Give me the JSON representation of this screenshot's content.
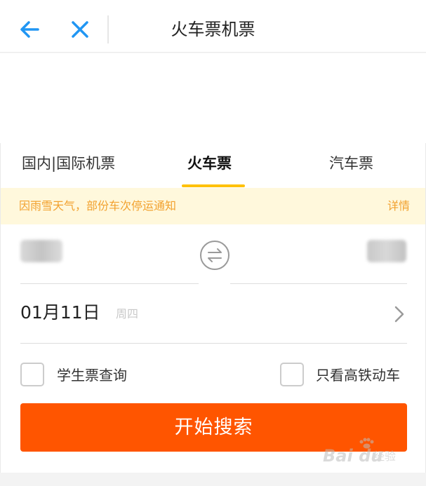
{
  "header": {
    "title": "火车票机票",
    "back_icon": "arrow-left-icon",
    "close_icon": "close-icon",
    "accent_color": "#2196f3"
  },
  "tabs": [
    {
      "label": "国内|国际机票",
      "active": false
    },
    {
      "label": "火车票",
      "active": true
    },
    {
      "label": "汽车票",
      "active": false
    }
  ],
  "tab_indicator_color": "#ffc107",
  "notice": {
    "text": "因雨雪天气，部份车次停运通知",
    "link": "详情",
    "color": "#f2a12e"
  },
  "stations": {
    "swap_icon": "swap-icon"
  },
  "date": {
    "value": "01月11日",
    "weekday": "周四",
    "chevron_icon": "chevron-right-icon"
  },
  "options": {
    "student_label": "学生票查询",
    "gaotie_label": "只看高铁动车"
  },
  "search": {
    "label": "开始搜索",
    "color": "#ff5500"
  },
  "watermark": {
    "logo": "Bai du",
    "sub": "经验"
  }
}
